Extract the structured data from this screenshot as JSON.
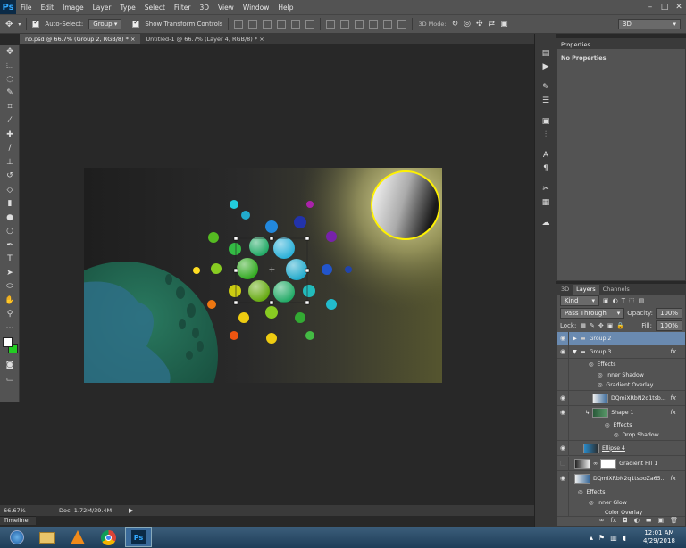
{
  "app": {
    "logo": "Ps"
  },
  "menu": [
    "File",
    "Edit",
    "Image",
    "Layer",
    "Type",
    "Select",
    "Filter",
    "3D",
    "View",
    "Window",
    "Help"
  ],
  "options": {
    "auto_select_label": "Auto-Select:",
    "auto_select_value": "Group",
    "transform_label": "Show Transform Controls",
    "mode_label": "3D Mode:",
    "workspace": "3D"
  },
  "tabs": [
    {
      "label": "no.psd @ 66.7% (Group 2, RGB/8) *",
      "close": "×",
      "active": true
    },
    {
      "label": "Untitled-1 @ 66.7% (Layer 4, RGB/8) *",
      "close": "×",
      "active": false
    }
  ],
  "status": {
    "zoom": "66.67%",
    "doc": "Doc: 1.72M/39.4M"
  },
  "timeline": "Timeline",
  "properties": {
    "tab": "Properties",
    "content": "No Properties"
  },
  "layers_panel": {
    "tabs": [
      "3D",
      "Layers",
      "Channels"
    ],
    "filter": "Kind",
    "blend_mode": "Pass Through",
    "opacity_label": "Opacity:",
    "opacity_value": "100%",
    "lock_label": "Lock:",
    "fill_label": "Fill:",
    "fill_value": "100%",
    "rows": [
      {
        "name": "Group 2"
      },
      {
        "name": "Group 3"
      },
      {
        "name": "Effects"
      },
      {
        "name": "Inner Shadow"
      },
      {
        "name": "Gradient Overlay"
      },
      {
        "name": "DQmiXRbN2q1tsb..."
      },
      {
        "name": "Shape 1"
      },
      {
        "name": "Effects"
      },
      {
        "name": "Drop Shadow"
      },
      {
        "name": "Ellipse 4"
      },
      {
        "name": "Gradient Fill 1"
      },
      {
        "name": "DQmiXRbN2q1tsboZa65..."
      },
      {
        "name": "Effects"
      },
      {
        "name": "Inner Glow"
      },
      {
        "name": "Color Overlay"
      }
    ]
  },
  "clock": {
    "time": "12:01 AM",
    "date": "4/29/2018"
  },
  "colors": {
    "bg": "#282828",
    "panel": "#535353",
    "selected_layer": "#6a8ab0",
    "fg_swatch": "#ffffff",
    "bg_swatch": "#22cc22"
  }
}
